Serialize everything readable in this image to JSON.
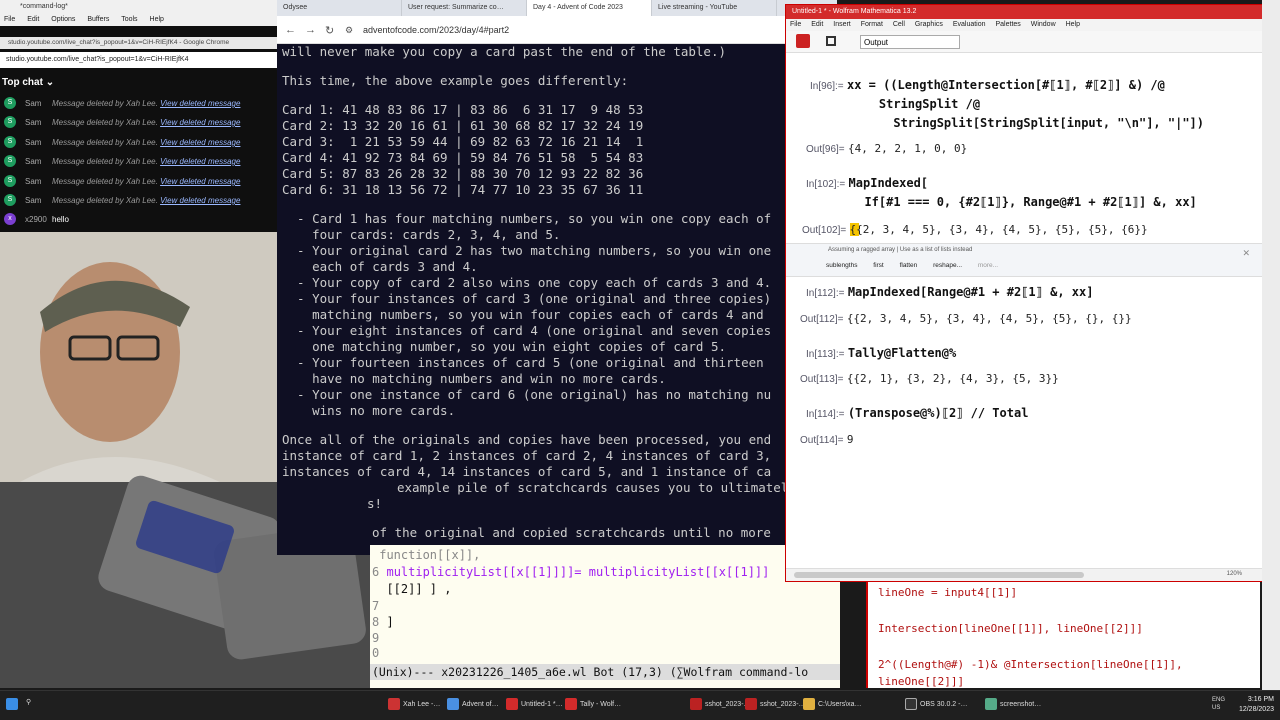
{
  "chat_window": {
    "title": "*command-log*",
    "menu": [
      "File",
      "Edit",
      "Options",
      "Buffers",
      "Tools",
      "Help"
    ],
    "url_bg": "studio.youtube.com/live_chat?is_popout=1&v=CiH-RIEjfK4 - Google Chrome",
    "url": "studio.youtube.com/live_chat?is_popout=1&v=CiH-RIEjfK4",
    "top_chat_label": "Top chat",
    "messages": [
      {
        "avatar": "S",
        "name": "Sam",
        "text": "Message deleted by Xah Lee.",
        "link": "View deleted message"
      },
      {
        "avatar": "S",
        "name": "Sam",
        "text": "Message deleted by Xah Lee.",
        "link": "View deleted message"
      },
      {
        "avatar": "S",
        "name": "Sam",
        "text": "Message deleted by Xah Lee.",
        "link": "View deleted message"
      },
      {
        "avatar": "S",
        "name": "Sam",
        "text": "Message deleted by Xah Lee.",
        "link": "View deleted message"
      },
      {
        "avatar": "S",
        "name": "Sam",
        "text": "Message deleted by Xah Lee.",
        "link": "View deleted message"
      },
      {
        "avatar": "S",
        "name": "Sam",
        "text": "Message deleted by Xah Lee.",
        "link": "View deleted message"
      },
      {
        "avatar": "x",
        "name": "x2900",
        "text": "hello",
        "link": ""
      }
    ]
  },
  "browser": {
    "tabs": [
      "Odysee",
      "User request: Summarize co…",
      "Day 4 - Advent of Code 2023",
      "Live streaming - YouTube"
    ],
    "url": "adventofcode.com/2023/day/4#part2",
    "lines": [
      "will never make you copy a card past the end of the table.)",
      "",
      "This time, the above example goes differently:",
      "",
      "Card 1: 41 48 83 86 17 | 83 86  6 31 17  9 48 53",
      "Card 2: 13 32 20 16 61 | 61 30 68 82 17 32 24 19",
      "Card 3:  1 21 53 59 44 | 69 82 63 72 16 21 14  1",
      "Card 4: 41 92 73 84 69 | 59 84 76 51 58  5 54 83",
      "Card 5: 87 83 26 28 32 | 88 30 70 12 93 22 82 36",
      "Card 6: 31 18 13 56 72 | 74 77 10 23 35 67 36 11",
      "",
      "  - Card 1 has four matching numbers, so you win one copy each of",
      "    four cards: cards 2, 3, 4, and 5.",
      "  - Your original card 2 has two matching numbers, so you win one",
      "    each of cards 3 and 4.",
      "  - Your copy of card 2 also wins one copy each of cards 3 and 4.",
      "  - Your four instances of card 3 (one original and three copies)",
      "    matching numbers, so you win four copies each of cards 4 and",
      "  - Your eight instances of card 4 (one original and seven copies",
      "    one matching number, so you win eight copies of card 5.",
      "  - Your fourteen instances of card 5 (one original and thirteen",
      "    have no matching numbers and win no more cards.",
      "  - Your one instance of card 6 (one original) has no matching nu",
      "    wins no more cards.",
      "",
      "Once all of the originals and copies have been processed, you end",
      "instance of card 1, 2 instances of card 2, 4 instances of card 3,",
      "instances of card 4, 14 instances of card 5, and 1 instance of ca",
      "example pile of scratchcards causes you to ultimately",
      "s!",
      "",
      "of the original and copied scratchcards until no more"
    ]
  },
  "wolfram": {
    "title": "Untitled-1 * - Wolfram Mathematica 13.2",
    "menu": [
      "File",
      "Edit",
      "Insert",
      "Format",
      "Cell",
      "Graphics",
      "Evaluation",
      "Palettes",
      "Window",
      "Help"
    ],
    "style_select": "Output",
    "cells": [
      {
        "label": "In[96]:=",
        "code": "xx = ((Length@Intersection[#⟦1⟧, #⟦2⟧] &) /@"
      },
      {
        "label": "",
        "code": "    StringSplit /@"
      },
      {
        "label": "",
        "code": "      StringSplit[StringSplit[input, \"\\n\"], \"|\"])"
      },
      {
        "label": "Out[96]=",
        "code": "{4, 2, 2, 1, 0, 0}"
      },
      {
        "label": "In[102]:=",
        "code": "MapIndexed["
      },
      {
        "label": "",
        "code": "  If[#1 === 0, {#2⟦1⟧}, Range@#1 + #2⟦1⟧] &, xx]"
      },
      {
        "label": "Out[102]=",
        "code": "{{2, 3, 4, 5}, {3, 4}, {4, 5}, {5}, {5}, {6}}"
      },
      {
        "label": "In[112]:=",
        "code": "MapIndexed[Range@#1 + #2⟦1⟧ &, xx]"
      },
      {
        "label": "Out[112]=",
        "code": "{{2, 3, 4, 5}, {3, 4}, {4, 5}, {5}, {}, {}}"
      },
      {
        "label": "In[113]:=",
        "code": "Tally@Flatten@%"
      },
      {
        "label": "Out[113]=",
        "code": "{{2, 1}, {3, 2}, {4, 3}, {5, 3}}"
      },
      {
        "label": "In[114]:=",
        "code": "(Transpose@%)⟦2⟧ // Total"
      },
      {
        "label": "Out[114]=",
        "code": "9"
      }
    ],
    "suggestion_note": "Assuming a ragged array | Use as a list of lists instead",
    "suggestion_buttons": [
      "sublengths",
      "first",
      "flatten",
      "reshape...",
      "more..."
    ],
    "zoom": "120%"
  },
  "notebook2": {
    "lines": [
      "lineOne = input4[[1]]",
      "",
      "Intersection[lineOne[[1]], lineOne[[2]]]",
      "",
      "2^((Length@#) -1)& @Intersection[lineOne[[1]],",
      "lineOne[[2]]]"
    ]
  },
  "emacs": {
    "lines": [
      {
        "num": "",
        "text": "function[[x]],"
      },
      {
        "num": "6",
        "text": "multiplicityList[[x[[1]]]]= multiplicityList[[x[[1]]]"
      },
      {
        "num": "",
        "text": "[[2]] ] ,"
      },
      {
        "num": "7",
        "text": ""
      },
      {
        "num": "8",
        "text": "]"
      },
      {
        "num": "9",
        "text": ""
      },
      {
        "num": "0",
        "text": ""
      }
    ],
    "modeline": "(Unix)--- x20231226_1405_a6e.wl Bot (17,3) (∑Wolfram command-lo"
  },
  "taskbar": {
    "items": [
      "Xah Lee -…",
      "Advent of…",
      "Untitled-1 *…",
      "Tally - Wolf…",
      "sshot_2023-…",
      "sshot_2023-…",
      "C:\\Users\\xa…",
      "OBS 30.0.2 -…",
      "screenshot…"
    ],
    "lang": "ENG\nUS",
    "time": "3:16 PM",
    "date": "12/28/2023"
  }
}
